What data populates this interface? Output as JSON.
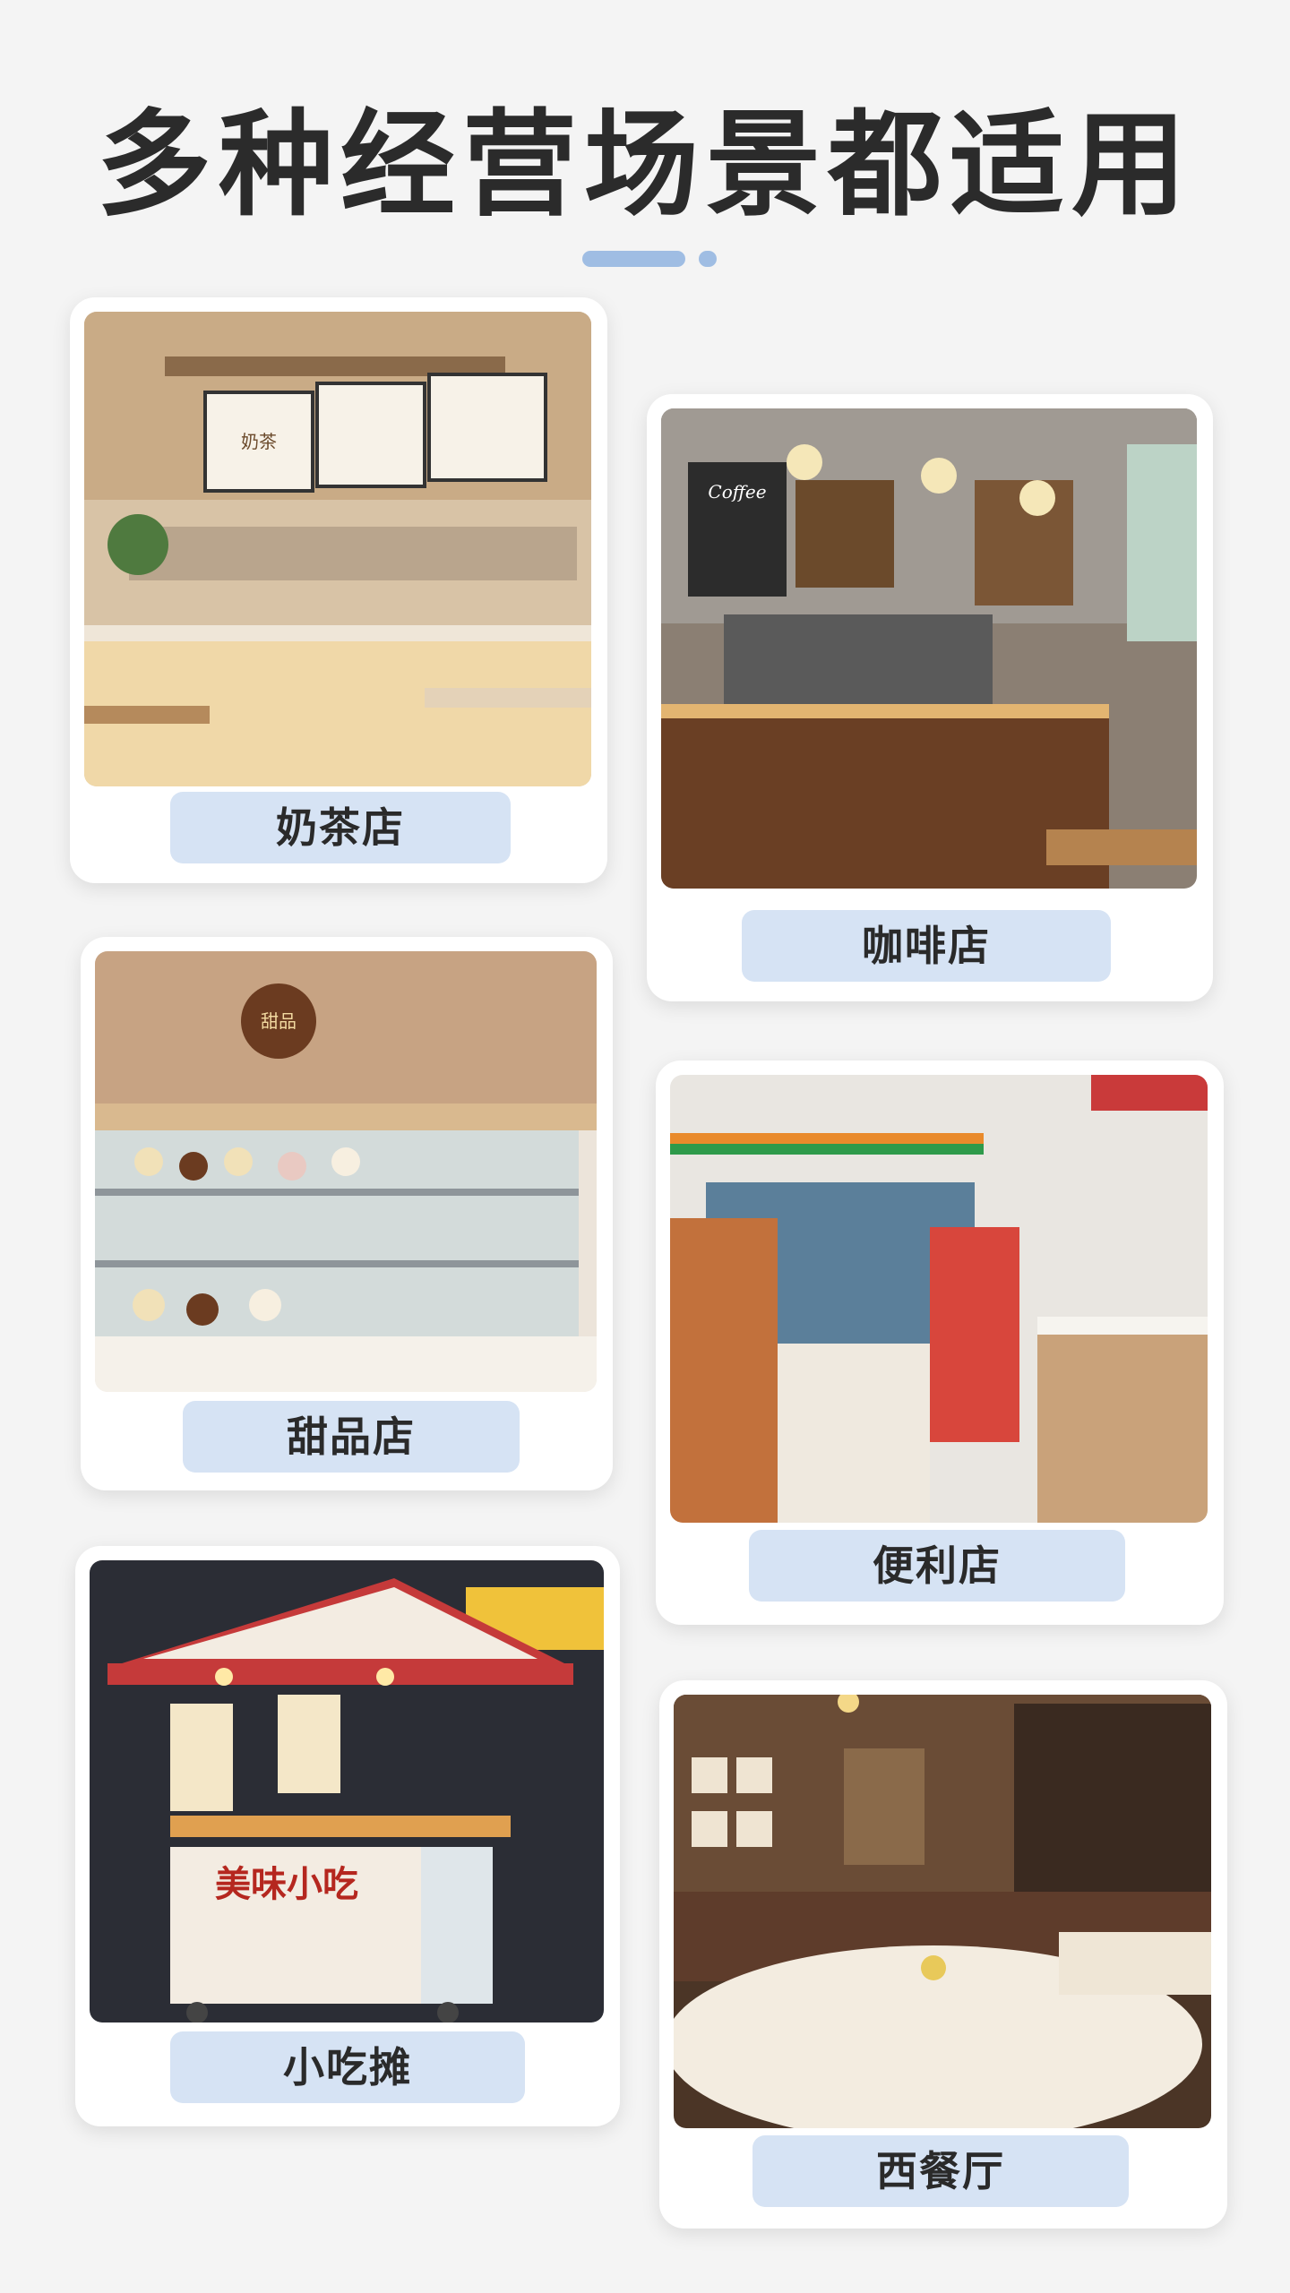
{
  "header": {
    "title": "多种经营场景都适用"
  },
  "scenes": [
    {
      "label": "奶茶店",
      "signage": [
        "奶茶"
      ]
    },
    {
      "label": "咖啡店",
      "signage": [
        "Coffee"
      ]
    },
    {
      "label": "甜品店",
      "signage": [
        "甜品"
      ]
    },
    {
      "label": "便利店",
      "signage": []
    },
    {
      "label": "小吃摊",
      "signage": [
        "美味小吃"
      ]
    },
    {
      "label": "西餐厅",
      "signage": []
    }
  ],
  "colors": {
    "background": "#f4f4f4",
    "title": "#2b2b2b",
    "label_bg": "#d6e3f4",
    "accent_bar": "#9fbde3"
  }
}
